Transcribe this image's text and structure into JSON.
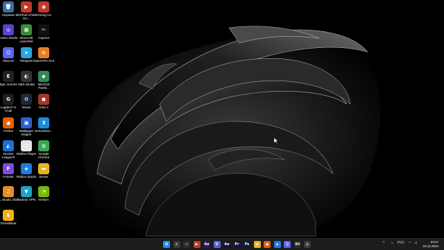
{
  "desktop": {
    "icons": [
      {
        "label": "Корзина",
        "glyph": "🗑",
        "color": "#3a6ea5",
        "icon": "recycle-bin-icon"
      },
      {
        "label": "MiniTool uTube Do...",
        "glyph": "▶",
        "color": "#c0392b",
        "icon": "minitool-utube-icon"
      },
      {
        "label": "Among Us",
        "glyph": "◉",
        "color": "#c0392b",
        "icon": "among-us-icon"
      },
      {
        "label": "Camo Studio",
        "glyph": "◎",
        "color": "#5b3fd1",
        "icon": "camo-studio-icon"
      },
      {
        "label": "Minecraft Launcher",
        "glyph": "▦",
        "color": "#3d8b37",
        "icon": "minecraft-launcher-icon"
      },
      {
        "label": "CapCut",
        "glyph": "✂",
        "color": "#111111",
        "icon": "capcut-icon"
      },
      {
        "label": "Discord",
        "glyph": "☺",
        "color": "#5865f2",
        "icon": "discord-icon"
      },
      {
        "label": "Telegram",
        "glyph": "➤",
        "color": "#2aa3df",
        "icon": "telegram-icon"
      },
      {
        "label": "OpenVPN GUI",
        "glyph": "⊙",
        "color": "#e67e22",
        "icon": "openvpn-icon"
      },
      {
        "label": "Epic Games",
        "glyph": "E",
        "color": "#222222",
        "icon": "epic-games-icon"
      },
      {
        "label": "OBS Studio",
        "glyph": "◐",
        "color": "#333333",
        "icon": "obs-studio-icon"
      },
      {
        "label": "MiniTool Partiti...",
        "glyph": "◆",
        "color": "#2e8b57",
        "icon": "minitool-partition-icon"
      },
      {
        "label": "Logitech G HUB",
        "glyph": "G",
        "color": "#1e1e1e",
        "icon": "logitech-ghub-icon"
      },
      {
        "label": "Steam",
        "glyph": "⚙",
        "color": "#1b2838",
        "icon": "steam-icon"
      },
      {
        "label": "Dota 2",
        "glyph": "◼",
        "color": "#a83226",
        "icon": "dota2-icon"
      },
      {
        "label": "Firefox",
        "glyph": "◕",
        "color": "#e66000",
        "icon": "firefox-icon"
      },
      {
        "label": "Wallpaper Engine",
        "glyph": "▣",
        "color": "#2d5fd1",
        "icon": "wallpaper-engine-icon"
      },
      {
        "label": "3uToolsOZ...",
        "glyph": "3",
        "color": "#1e8bd6",
        "icon": "3utools-icon"
      },
      {
        "label": "Rocket League®",
        "glyph": "◭",
        "color": "#1f6fd1",
        "icon": "rocket-league-icon"
      },
      {
        "label": "Roblox Player",
        "glyph": "◇",
        "color": "#e5e5e5",
        "icon": "roblox-player-icon"
      },
      {
        "label": "Google Chrome",
        "glyph": "◍",
        "color": "#34a853",
        "icon": "google-chrome-icon"
      },
      {
        "label": "Fortnite",
        "glyph": "F",
        "color": "#7a4ce0",
        "icon": "fortnite-icon"
      },
      {
        "label": "Roblox Studio",
        "glyph": "◈",
        "color": "#1e7be0",
        "icon": "roblox-studio-icon"
      },
      {
        "label": "Server",
        "glyph": "▬",
        "color": "#e6b422",
        "icon": "folder-icon"
      },
      {
        "label": "FL Studio 2024",
        "glyph": "♫",
        "color": "#e58e26",
        "icon": "fl-studio-icon"
      },
      {
        "label": "Radmin VPN",
        "glyph": "▼",
        "color": "#1fa0c8",
        "icon": "radmin-vpn-icon"
      },
      {
        "label": "NVIDIA",
        "glyph": "◔",
        "color": "#76b900",
        "icon": "nvidia-icon"
      },
      {
        "label": "TunnelBear",
        "glyph": "♞",
        "color": "#f2b01e",
        "icon": "tunnelbear-icon"
      }
    ]
  },
  "taskbar": {
    "apps": [
      {
        "glyph": "⊞",
        "color": "#1e8ff0",
        "icon": "start-windows-icon"
      },
      {
        "glyph": "⌕",
        "color": "#3a3a3a",
        "icon": "search-icon"
      },
      {
        "glyph": "▭",
        "color": "#2b2b2b",
        "icon": "task-view-icon"
      },
      {
        "glyph": "▶",
        "color": "#c0392b",
        "icon": "minitool-utube-icon"
      },
      {
        "glyph": "Ae",
        "color": "#2c1566",
        "icon": "after-effects-icon"
      },
      {
        "glyph": "V",
        "color": "#5b62e6",
        "icon": "video-editor-icon"
      },
      {
        "glyph": "Ae",
        "color": "#1b1038",
        "icon": "after-effects-icon"
      },
      {
        "glyph": "Pr",
        "color": "#1b1038",
        "icon": "premiere-pro-icon"
      },
      {
        "glyph": "Ps",
        "color": "#0b1a33",
        "icon": "photoshop-icon"
      },
      {
        "glyph": "▬",
        "color": "#e6b422",
        "icon": "file-explorer-icon"
      },
      {
        "glyph": "◕",
        "color": "#e66000",
        "icon": "firefox-icon"
      },
      {
        "glyph": "◈",
        "color": "#1e7be0",
        "icon": "roblox-studio-icon"
      },
      {
        "glyph": "☺",
        "color": "#5865f2",
        "icon": "discord-icon"
      },
      {
        "glyph": "iiii",
        "color": "#2b2b2b",
        "icon": "audio-app-icon"
      },
      {
        "glyph": "◎",
        "color": "#3a3a3a",
        "icon": "app-icon"
      }
    ],
    "tray": {
      "chevron": "^",
      "language": "РУС",
      "time": "23:27",
      "date": "19.12.2024"
    }
  }
}
